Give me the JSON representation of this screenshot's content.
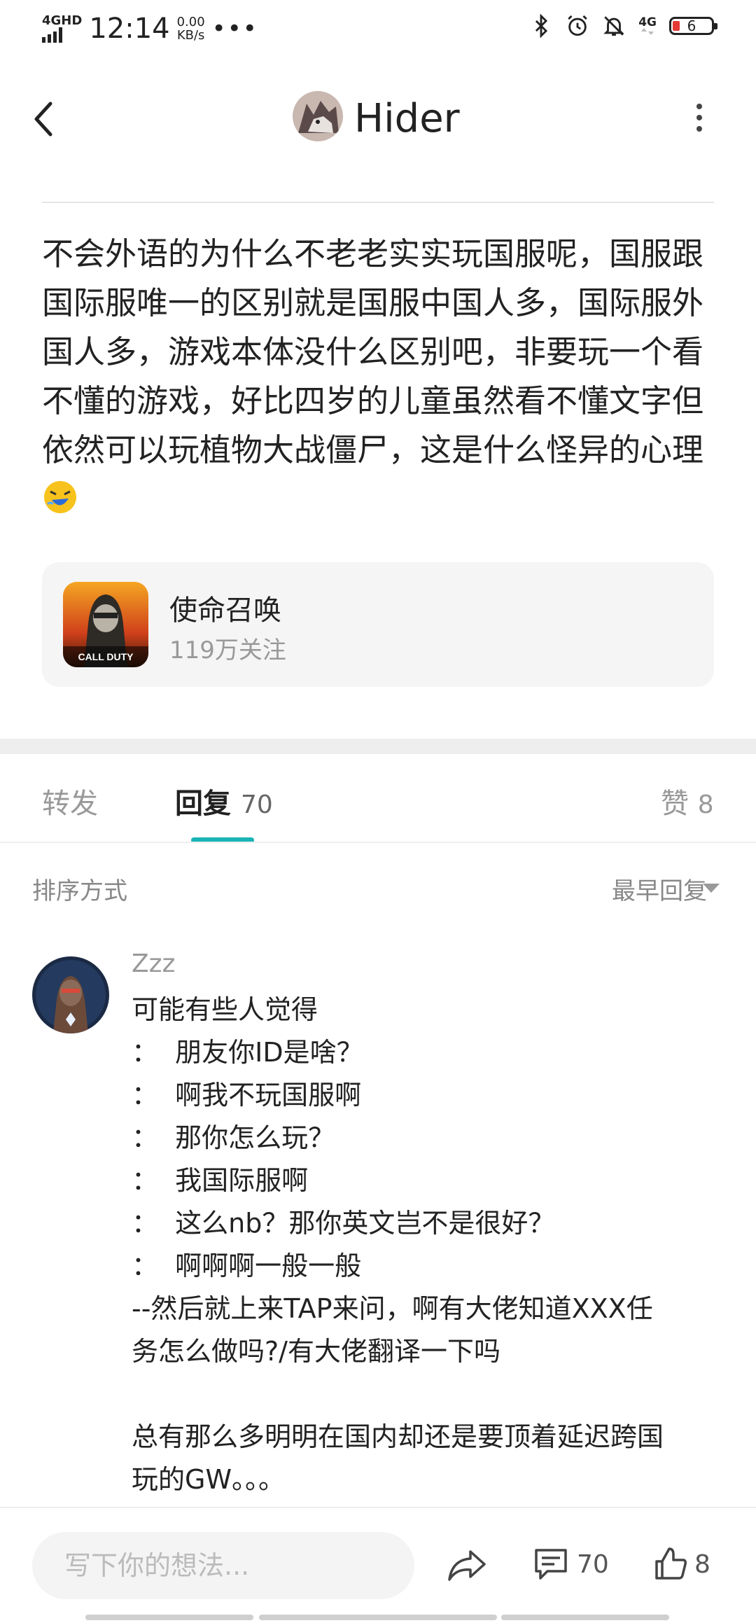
{
  "status_bar": {
    "network": "4GHD",
    "time": "12:14",
    "speed_value": "0.00",
    "speed_unit": "KB/s",
    "more": "•••",
    "network_right": "4G",
    "battery": "6"
  },
  "nav": {
    "title": "Hider"
  },
  "post": {
    "text": "不会外语的为什么不老老实实玩国服呢，国服跟国际服唯一的区别就是国服中国人多，国际服外国人多，游戏本体没什么区别吧，非要玩一个看不懂的游戏，好比四岁的儿童虽然看不懂文字但依然可以玩植物大战僵尸，这是什么怪异的心理"
  },
  "game_card": {
    "name": "使命召唤",
    "followers": "119万关注",
    "icon_text": "CALL DUTY"
  },
  "tabs": {
    "repost": "转发",
    "reply": "回复",
    "reply_count": "70",
    "like": "赞",
    "like_count": "8"
  },
  "sort": {
    "label": "排序方式",
    "value": "最早回复"
  },
  "comment": {
    "username": "Zzz",
    "lines": [
      "可能有些人觉得",
      "：  朋友你ID是啥？",
      "：  啊我不玩国服啊",
      "：  那你怎么玩？",
      "：  我国际服啊",
      "：  这么nb？那你英文岂不是很好？",
      "：  啊啊啊一般一般",
      "--然后就上来TAP来问，啊有大佬知道XXX任",
      "务怎么做吗?/有大佬翻译一下吗",
      "",
      "总有那么多明明在国内却还是要顶着延迟跨国",
      "玩的GW。。。"
    ]
  },
  "bottom_bar": {
    "input_placeholder": "写下你的想法...",
    "comment_count": "70",
    "like_count": "8"
  },
  "colors": {
    "accent": "#19b4b6",
    "text": "#222222",
    "muted": "#999999"
  }
}
